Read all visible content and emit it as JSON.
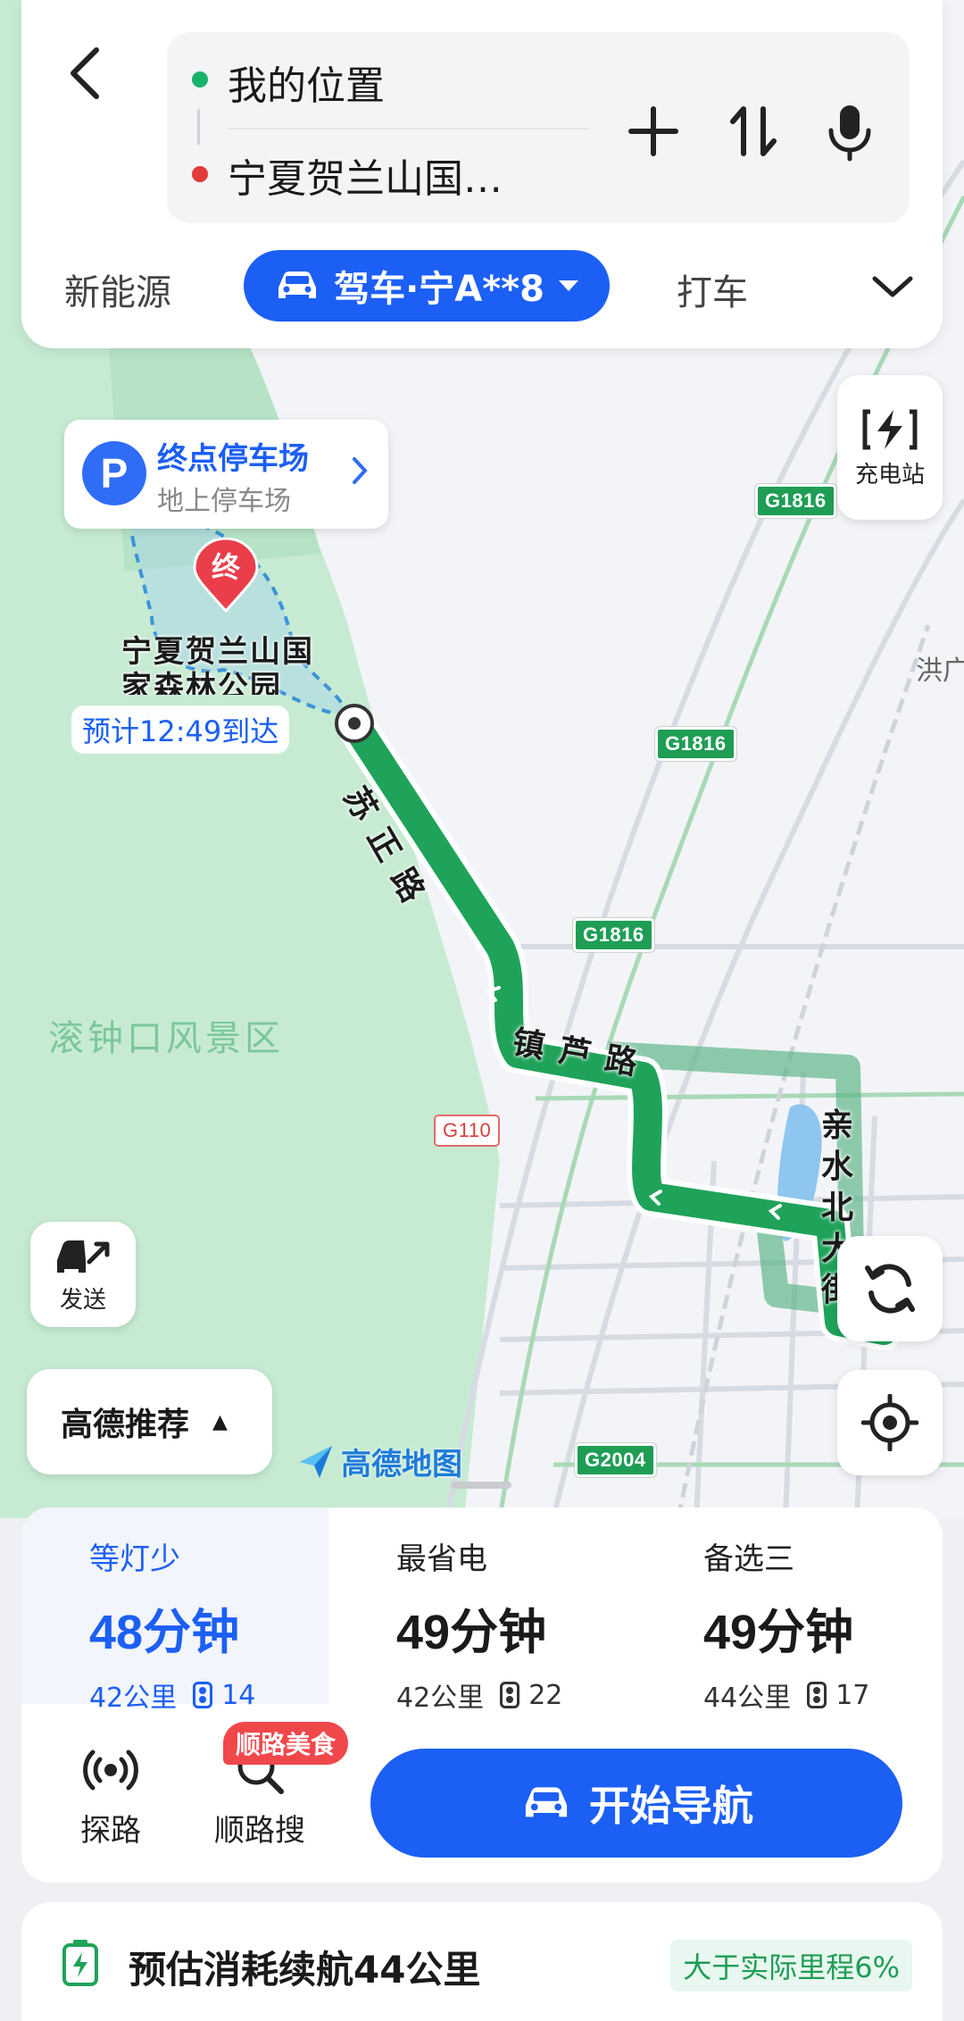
{
  "search": {
    "origin": "我的位置",
    "destination": "宁夏贺兰山国…",
    "icons": [
      "back-icon",
      "plus-icon",
      "swap-icon",
      "mic-icon"
    ]
  },
  "modes": {
    "left": "新能源",
    "selected": "驾车·宁A**8",
    "right": "打车"
  },
  "parking": {
    "icon": "P",
    "title": "终点停车场",
    "subtitle": "地上停车场"
  },
  "charging": {
    "label": "充电站"
  },
  "map": {
    "destination_marker": "终",
    "destination_name_line1": "宁夏贺兰山国",
    "destination_name_line2": "家森林公园",
    "eta": "预计12:49到达",
    "scenic_area": "滚钟口风景区",
    "road_labels": [
      "苏 正 路",
      "镇 芦 路",
      "亲 水 北 大 街"
    ],
    "badges": [
      "G1816",
      "G1816",
      "G1816",
      "G110",
      "G2004"
    ],
    "edge_text": "洪广",
    "logo": "高德地图",
    "colors": {
      "route": "#1fa35a",
      "alt_route": "#5fb78a",
      "forest": "#c6ebd2"
    }
  },
  "send": {
    "label": "发送"
  },
  "recommend": {
    "label": "高德推荐"
  },
  "routes": [
    {
      "name": "等灯少",
      "time_num": "48",
      "time_unit": "分钟",
      "distance": "42公里",
      "lights": "14",
      "selected": true
    },
    {
      "name": "最省电",
      "time_num": "49",
      "time_unit": "分钟",
      "distance": "42公里",
      "lights": "22",
      "selected": false
    },
    {
      "name": "备选三",
      "time_num": "49",
      "time_unit": "分钟",
      "distance": "44公里",
      "lights": "17",
      "selected": false
    }
  ],
  "actions": {
    "explore": "探路",
    "search_along": "顺路搜",
    "food_badge": "顺路美食",
    "start_nav": "开始导航"
  },
  "range": {
    "text": "预估消耗续航44公里",
    "badge": "大于实际里程6%"
  }
}
